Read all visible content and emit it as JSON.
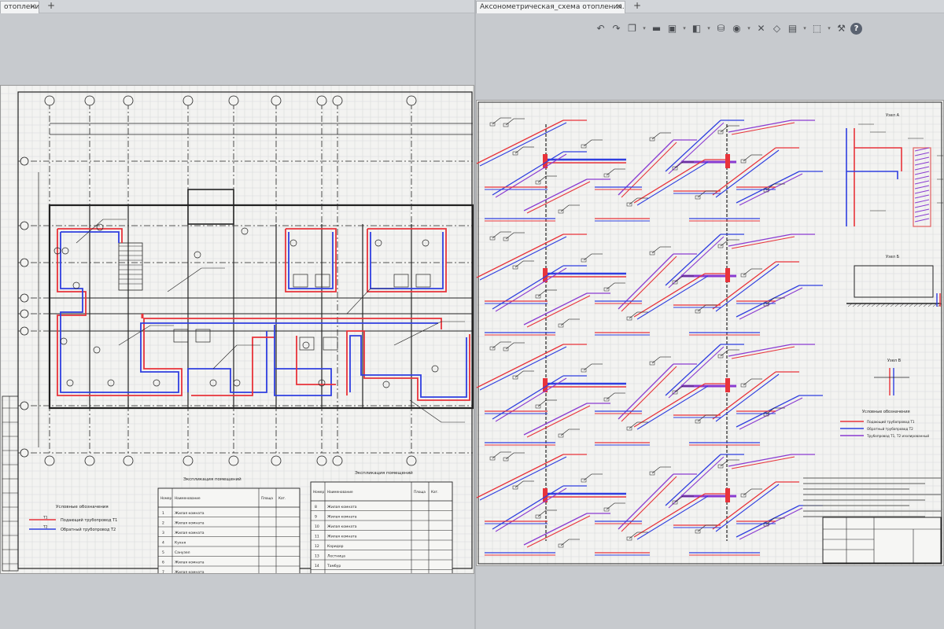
{
  "left_pane": {
    "tab": {
      "title": "отопления",
      "close_glyph": "×"
    },
    "add_tab_glyph": "+",
    "drawing": {
      "caption_below_plan": "Экспликация помещений",
      "caption_right_table": "Экспликация помещений",
      "legend": {
        "title": "Условные обозначения",
        "items": [
          {
            "label": "Подающий трубопровод Т1",
            "code": "Т1",
            "color": "#e8333a"
          },
          {
            "label": "Обратный трубопровод Т2",
            "code": "Т2",
            "color": "#2f3fe0"
          }
        ]
      },
      "table_left": {
        "headers": [
          "Номер помещения",
          "Наименование",
          "Площадь, м²",
          "Кат."
        ],
        "rows": [
          [
            "1",
            "Жилая комната",
            "",
            ""
          ],
          [
            "2",
            "Жилая комната",
            "",
            ""
          ],
          [
            "3",
            "Жилая комната",
            "",
            ""
          ],
          [
            "4",
            "Кухня",
            "",
            ""
          ],
          [
            "5",
            "Санузел",
            "",
            ""
          ],
          [
            "6",
            "Жилая комната",
            "",
            ""
          ],
          [
            "7",
            "Жилая комната",
            "",
            ""
          ]
        ]
      },
      "table_right": {
        "headers": [
          "Номер помещения",
          "Наименование",
          "Площадь, м²",
          "Кат."
        ],
        "rows": [
          [
            "8",
            "Жилая комната",
            "",
            ""
          ],
          [
            "9",
            "Жилая комната",
            "",
            ""
          ],
          [
            "10",
            "Жилая комната",
            "",
            ""
          ],
          [
            "11",
            "Жилая комната",
            "",
            ""
          ],
          [
            "12",
            "Коридор",
            "",
            ""
          ],
          [
            "13",
            "Лестница",
            "",
            ""
          ],
          [
            "14",
            "Тамбур",
            "",
            ""
          ]
        ]
      }
    }
  },
  "right_pane": {
    "tab": {
      "title": "Аксонометрическая_схема отопления...",
      "close_glyph": "×"
    },
    "add_tab_glyph": "+",
    "toolbar": {
      "icons": [
        "undo-icon",
        "redo-icon",
        "copy-view-icon",
        "measure-icon",
        "save-icon",
        "layers-icon",
        "print-icon",
        "location-icon",
        "cut-icon",
        "select-icon",
        "paste-icon",
        "cube-icon",
        "wrench-icon",
        "help-icon"
      ],
      "help_glyph": "?"
    },
    "drawing": {
      "legend": {
        "title": "Условные обозначения",
        "items": [
          {
            "label": "Подающий трубопровод Т1",
            "color": "#e8333a"
          },
          {
            "label": "Обратный трубопровод Т2",
            "color": "#2f3fe0"
          },
          {
            "label": "Трубопровод Т1, Т2 изолированный",
            "color": "#8a3bd1"
          }
        ]
      },
      "detail_labels": [
        "Узел А",
        "Узел Б",
        "Узел В"
      ]
    }
  },
  "colors": {
    "supply": "#e8333a",
    "return": "#2f3fe0",
    "combined": "#8a3bd1",
    "ink": "#222222",
    "grid": "#d9dadb"
  }
}
